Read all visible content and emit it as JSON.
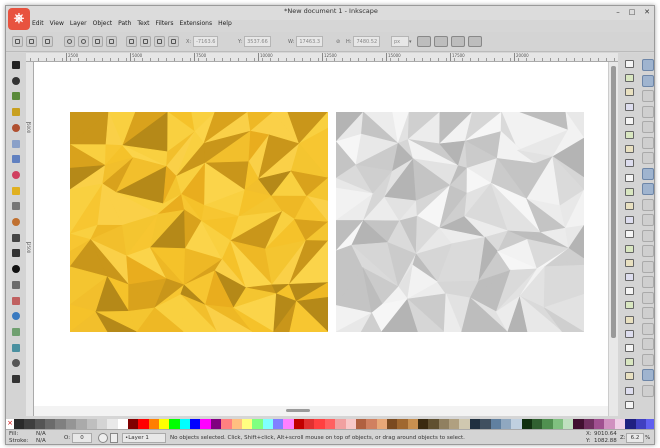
{
  "window": {
    "title": "*New document 1 - Inkscape",
    "logo_glyph": "⎈",
    "controls": {
      "minimize": "–",
      "maximize": "□",
      "close": "✕"
    }
  },
  "menu": [
    "Edit",
    "View",
    "Layer",
    "Object",
    "Path",
    "Text",
    "Filters",
    "Extensions",
    "Help"
  ],
  "toolbar": {
    "x_label": "X:",
    "x_value": "-7163.6",
    "y_label": "Y:",
    "y_value": "3537.66",
    "w_label": "W:",
    "w_value": "17463.3",
    "h_label": "H:",
    "h_value": "7480.52",
    "unit": "px"
  },
  "ruler": {
    "top_ticks": [
      "2500",
      "5000",
      "7500",
      "10000",
      "12500",
      "15000",
      "17500",
      "20000"
    ],
    "left_ticks": [
      "5000",
      "2500"
    ]
  },
  "artwork": {
    "left_panel": {
      "theme": "yellow-low-poly",
      "base_color": "#f7c631"
    },
    "right_panel": {
      "theme": "grey-low-poly",
      "base_color": "#e0e0e0"
    }
  },
  "palette": [
    "#2a2a2a",
    "#3e3e3e",
    "#555",
    "#6b6b6b",
    "#808080",
    "#959595",
    "#aaaaaa",
    "#bfbfbf",
    "#d4d4d4",
    "#e9e9e9",
    "#ffffff",
    "#800000",
    "#ff0000",
    "#ff7f00",
    "#ffff00",
    "#00ff00",
    "#00ffff",
    "#0000ff",
    "#ff00ff",
    "#800080",
    "#ff8080",
    "#ffbf80",
    "#ffff80",
    "#80ff80",
    "#80ffff",
    "#8080ff",
    "#ff80ff",
    "#c00000",
    "#e03030",
    "#ff4040",
    "#ff6060",
    "#f0a0a0",
    "#f8c8c8",
    "#b06040",
    "#d08060",
    "#e8a878",
    "#7a4a20",
    "#a06830",
    "#c89050",
    "#3a2a10",
    "#605030",
    "#908060",
    "#b0a080",
    "#d0c8b0",
    "#203040",
    "#405060",
    "#6080a0",
    "#90a8c0",
    "#c0d0e0",
    "#103010",
    "#306030",
    "#509050",
    "#80c080",
    "#c0e0c0",
    "#401030",
    "#703060",
    "#a05090",
    "#d090c0",
    "#f0d0e8",
    "#202080",
    "#4040c0",
    "#6060f0"
  ],
  "status": {
    "fill_label": "Fill:",
    "fill_value": "N/A",
    "stroke_label": "Stroke:",
    "stroke_value": "N/A",
    "opacity_label": "O:",
    "opacity_value": "0",
    "layer_value": "•Layer 1",
    "message": "No objects selected. Click, Shift+click, Alt+scroll mouse on top of objects, or drag around objects to select.",
    "x_label": "X:",
    "x_value": "9010.64",
    "y_label": "Y:",
    "y_value": "1082.88",
    "zoom_label": "Z:",
    "zoom_value": "6.2",
    "zoom_unit": "%"
  }
}
